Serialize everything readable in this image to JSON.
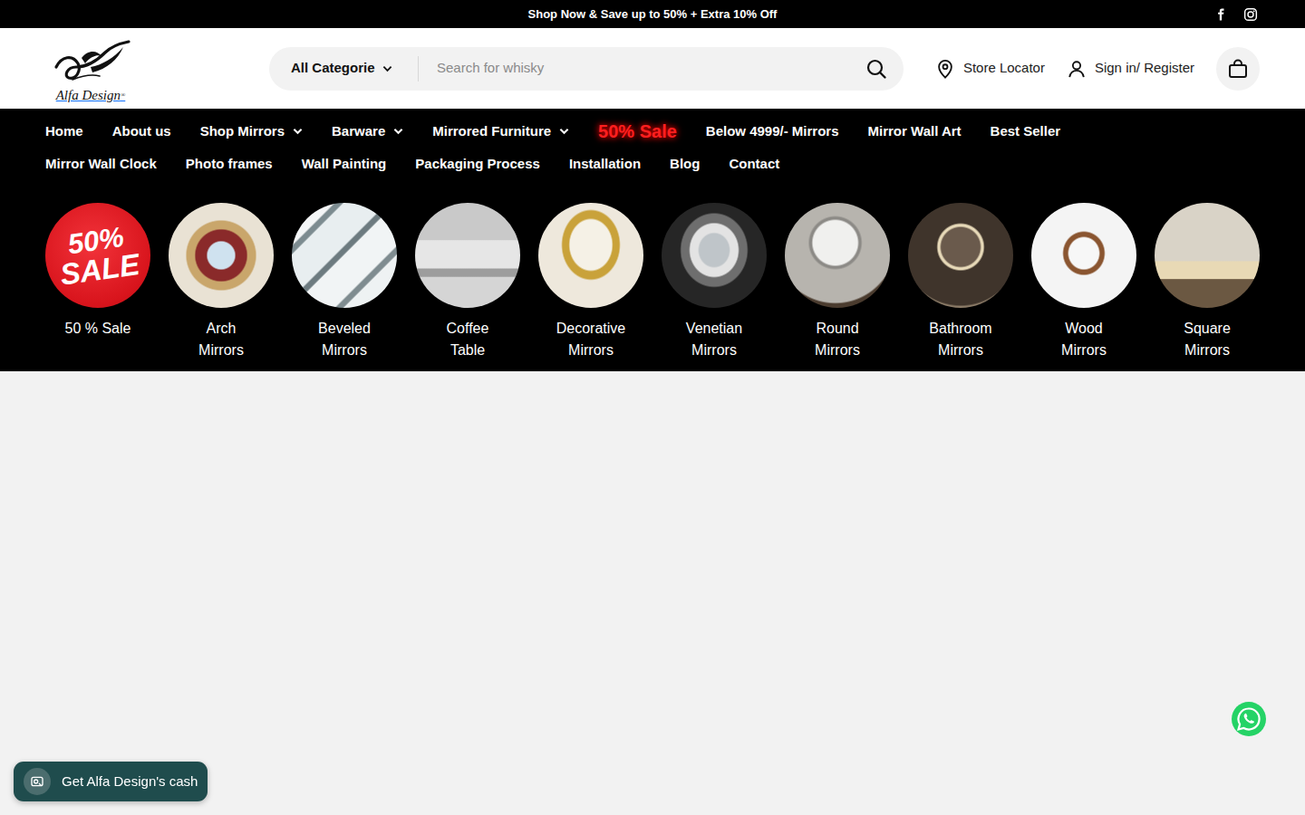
{
  "announcement": {
    "text": "Shop Now & Save up to 50% + Extra 10% Off"
  },
  "logo": {
    "text": "Alfa Design",
    "mark": "®"
  },
  "search": {
    "category": "All Categorie",
    "placeholder": "Search for whisky"
  },
  "header_links": [
    {
      "label": "Store Locator"
    },
    {
      "label": "Sign in/ Register"
    }
  ],
  "nav": {
    "rows": [
      [
        {
          "label": "Home",
          "has_menu": false,
          "highlight": false
        },
        {
          "label": "About us",
          "has_menu": false,
          "highlight": false
        },
        {
          "label": "Shop Mirrors",
          "has_menu": true,
          "highlight": false
        },
        {
          "label": "Barware",
          "has_menu": true,
          "highlight": false
        },
        {
          "label": "Mirrored Furniture",
          "has_menu": true,
          "highlight": false
        },
        {
          "label": "50% Sale",
          "has_menu": false,
          "highlight": true
        },
        {
          "label": "Below 4999/- Mirrors",
          "has_menu": false,
          "highlight": false
        },
        {
          "label": "Mirror Wall Art",
          "has_menu": false,
          "highlight": false
        },
        {
          "label": "Best Seller",
          "has_menu": false,
          "highlight": false
        }
      ],
      [
        {
          "label": "Mirror Wall Clock",
          "has_menu": false,
          "highlight": false
        },
        {
          "label": "Photo frames",
          "has_menu": false,
          "highlight": false
        },
        {
          "label": "Wall Painting",
          "has_menu": false,
          "highlight": false
        },
        {
          "label": "Packaging Process",
          "has_menu": false,
          "highlight": false
        },
        {
          "label": "Installation",
          "has_menu": false,
          "highlight": false
        },
        {
          "label": "Blog",
          "has_menu": false,
          "highlight": false
        },
        {
          "label": "Contact",
          "has_menu": false,
          "highlight": false
        }
      ]
    ]
  },
  "categories": [
    {
      "label": "50 % Sale",
      "kind": "badge",
      "badge_lines": [
        "50%",
        "SALE"
      ]
    },
    {
      "label": "Arch Mirrors",
      "kind": "photo"
    },
    {
      "label": "Beveled Mirrors",
      "kind": "photo"
    },
    {
      "label": "Coffee Table",
      "kind": "photo"
    },
    {
      "label": "Decorative Mirrors",
      "kind": "photo"
    },
    {
      "label": "Venetian Mirrors",
      "kind": "photo"
    },
    {
      "label": "Round Mirrors",
      "kind": "photo"
    },
    {
      "label": "Bathroom Mirrors",
      "kind": "photo"
    },
    {
      "label": "Wood Mirrors",
      "kind": "photo"
    },
    {
      "label": "Square Mirrors",
      "kind": "photo"
    }
  ],
  "cash_button": {
    "label": "Get Alfa Design's cash"
  }
}
